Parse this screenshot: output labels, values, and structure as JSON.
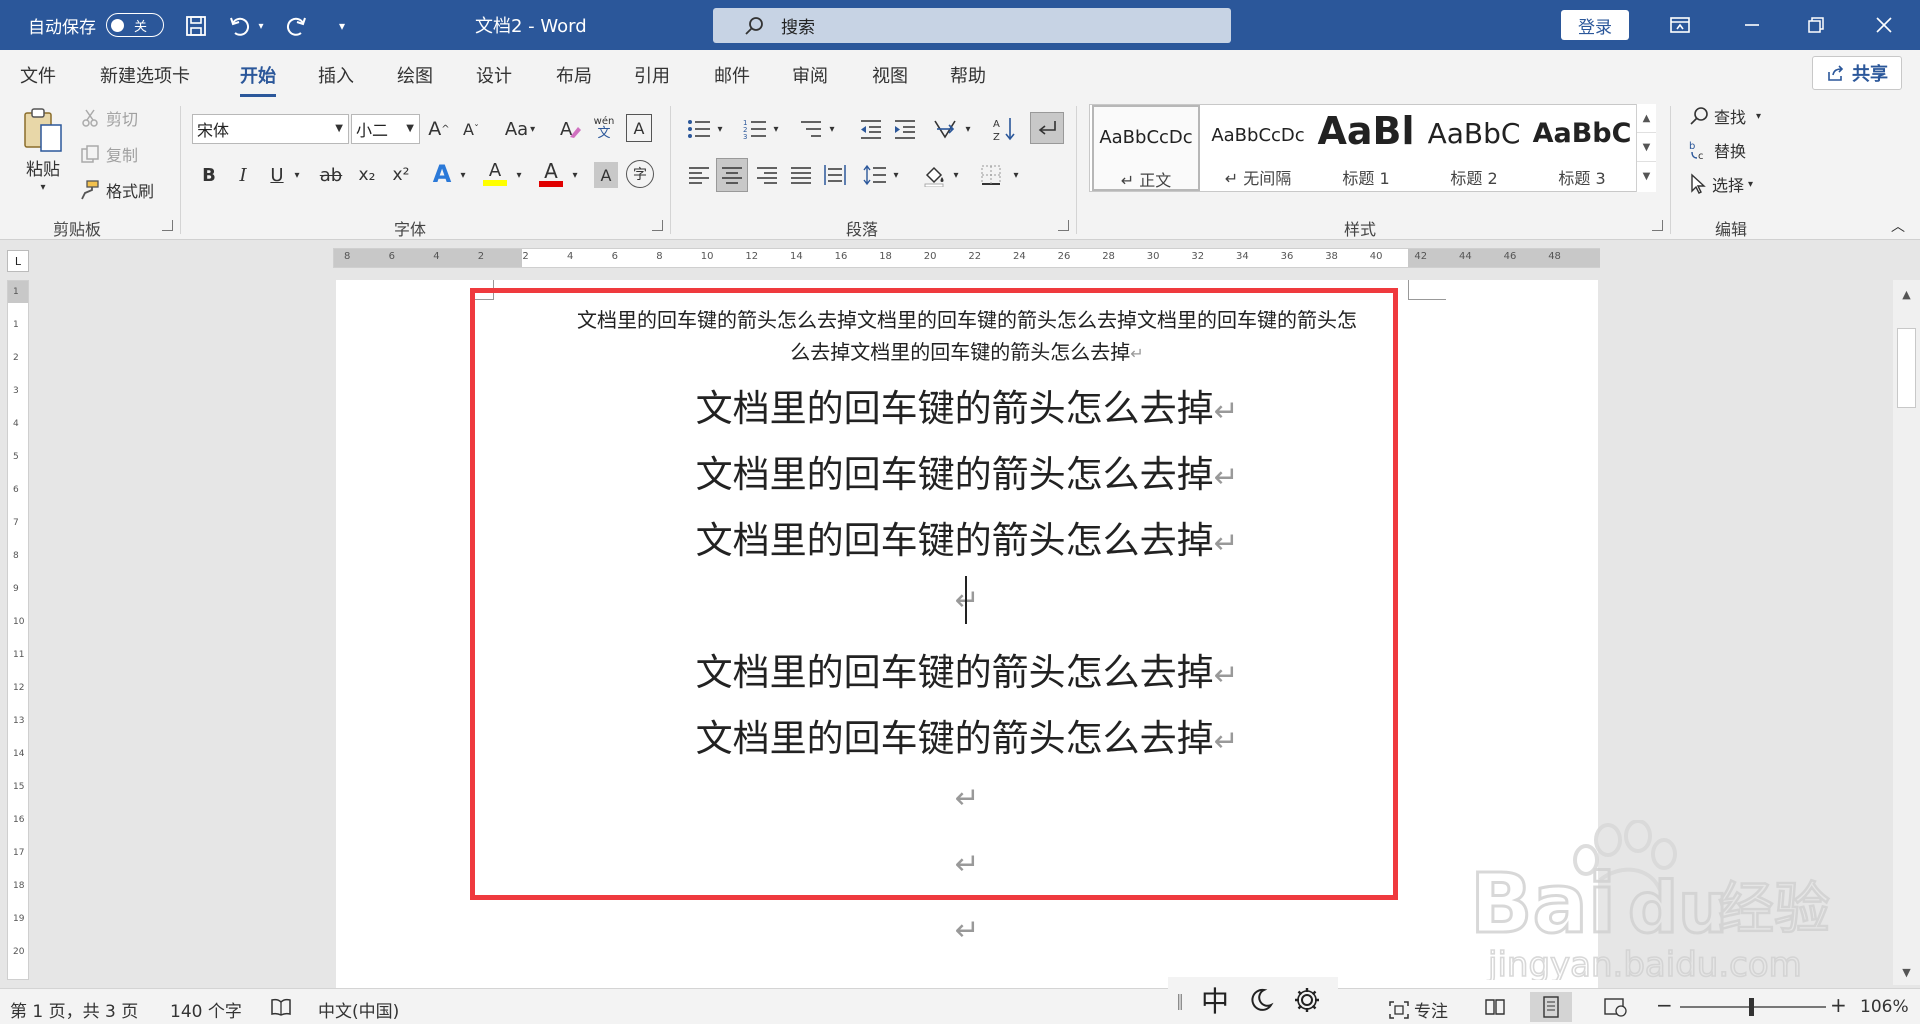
{
  "titlebar": {
    "autosave_label": "自动保存",
    "autosave_state": "关",
    "doc_title": "文档2  -  Word",
    "search_placeholder": "搜索",
    "login_label": "登录"
  },
  "tabs": [
    "文件",
    "新建选项卡",
    "开始",
    "插入",
    "绘图",
    "设计",
    "布局",
    "引用",
    "邮件",
    "审阅",
    "视图",
    "帮助"
  ],
  "active_tab": "开始",
  "share_label": "共享",
  "ribbon": {
    "clipboard": {
      "paste": "粘贴",
      "cut": "剪切",
      "copy": "复制",
      "format_painter": "格式刷",
      "label": "剪贴板"
    },
    "font": {
      "font_name": "宋体",
      "font_size": "小二",
      "label": "字体",
      "change_case": "Aa",
      "phonetic_top": "wén",
      "phonetic_bottom": "文",
      "bold": "B",
      "italic": "I",
      "underline": "U",
      "strike": "ab",
      "subscript": "x₂",
      "superscript": "x²",
      "text_effect": "A",
      "highlight": "A",
      "font_color": "A",
      "char_shading": "A",
      "enclose": "字"
    },
    "paragraph": {
      "label": "段落"
    },
    "styles": {
      "label": "样式",
      "items": [
        {
          "sample": "AaBbCcDc",
          "name": "↵ 正文"
        },
        {
          "sample": "AaBbCcDc",
          "name": "↵ 无间隔"
        },
        {
          "sample": "AaBl",
          "name": "标题 1"
        },
        {
          "sample": "AaBbC",
          "name": "标题 2"
        },
        {
          "sample": "AaBbC",
          "name": "标题 3"
        }
      ]
    },
    "editing": {
      "find": "查找",
      "replace": "替换",
      "select": "选择",
      "label": "编辑"
    }
  },
  "ruler": {
    "h_numbers": [
      "8",
      "6",
      "4",
      "2",
      "2",
      "4",
      "6",
      "8",
      "10",
      "12",
      "14",
      "16",
      "18",
      "20",
      "22",
      "24",
      "26",
      "28",
      "30",
      "32",
      "34",
      "36",
      "38",
      "40",
      "42",
      "44",
      "46",
      "48"
    ],
    "v_numbers": [
      "1",
      "1",
      "2",
      "3",
      "4",
      "5",
      "6",
      "7",
      "8",
      "9",
      "10",
      "11",
      "12",
      "13",
      "14",
      "15",
      "16",
      "17",
      "18",
      "19",
      "20"
    ]
  },
  "document": {
    "small_line_1": "文档里的回车键的箭头怎么去掉文档里的回车键的箭头怎么去掉文档里的回车键的箭头怎",
    "small_line_2": "么去掉文档里的回车键的箭头怎么去掉",
    "big_lines": [
      "文档里的回车键的箭头怎么去掉",
      "文档里的回车键的箭头怎么去掉",
      "文档里的回车键的箭头怎么去掉",
      "",
      "文档里的回车键的箭头怎么去掉",
      "文档里的回车键的箭头怎么去掉",
      "",
      "",
      ""
    ],
    "paragraph_mark": "↵",
    "highlight_color": "#ef3a3e"
  },
  "ime": {
    "lang": "中"
  },
  "status": {
    "page": "第 1 页，共 3 页",
    "words": "140 个字",
    "language": "中文(中国)",
    "focus": "专注",
    "zoom_minus": "−",
    "zoom_plus": "+",
    "zoom": "106%"
  },
  "watermark": {
    "brand": "Bai",
    "brand2": "du",
    "cn": "经验",
    "url": "jingyan.baidu.com"
  },
  "colors": {
    "accent": "#2b579a",
    "ribbon_bg": "#f3f3f3",
    "highlight_yellow": "#ffff00",
    "font_red": "#e00000"
  }
}
